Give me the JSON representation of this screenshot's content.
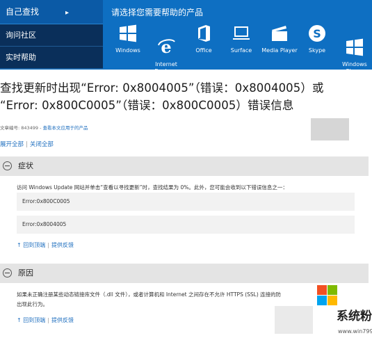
{
  "leftmenu": {
    "header": "自己查找",
    "chevron": "▸",
    "items": [
      "询问社区",
      "实时帮助"
    ]
  },
  "products": {
    "title": "请选择您需要帮助的产品",
    "items": [
      {
        "label": "Windows",
        "icon": "windows-logo-icon"
      },
      {
        "label": "Internet\nExplorer",
        "icon": "internet-explorer-icon"
      },
      {
        "label": "Office",
        "icon": "office-icon"
      },
      {
        "label": "Surface",
        "icon": "surface-laptop-icon"
      },
      {
        "label": "Media Player",
        "icon": "media-player-clapper-icon"
      },
      {
        "label": "Skype",
        "icon": "skype-icon"
      },
      {
        "label": "Windows\nPhone",
        "icon": "windows-phone-icon"
      }
    ]
  },
  "article": {
    "title_line1": "查找更新时出现“Error: 0x8004005”（错误：0x8004005）或",
    "title_line2": "“Error: 0x800C0005”（错误：0x800C0005）错误信息",
    "meta_prefix": "文章编号: 843499 - ",
    "meta_link": "查看本文应用于的产品",
    "expand_all": "展开全部",
    "collapse_all": "关闭全部",
    "sep": "|"
  },
  "symptom": {
    "title": "症状",
    "text": "访问 Windows Update 网站并单击“查看以寻找更新”时，查找结果为 0%。此外，您可能会收到以下错误信息之一：",
    "errors": [
      "Error:0x800C0005",
      "Error:0x8004005"
    ],
    "back_top": "↑ 回到顶端",
    "feedback": "提供反馈"
  },
  "cause": {
    "title": "原因",
    "text_line1": "如果未正确注册某些动态链接库文件（.dll 文件），或者计算机和 Internet 之间存在不允许 HTTPS (SSL) 连接的防",
    "text_line2": "出现此行为。",
    "back_top": "↑ 回到顶端",
    "feedback": "提供反馈"
  },
  "watermark": {
    "text": "系统粉",
    "url": "www.win7999.com"
  },
  "colors": {
    "nav_blue": "#0e6fc2",
    "nav_dark": "#0a2f5a",
    "link_blue": "#1f6fbf",
    "section_gray": "#e4e4e4"
  }
}
